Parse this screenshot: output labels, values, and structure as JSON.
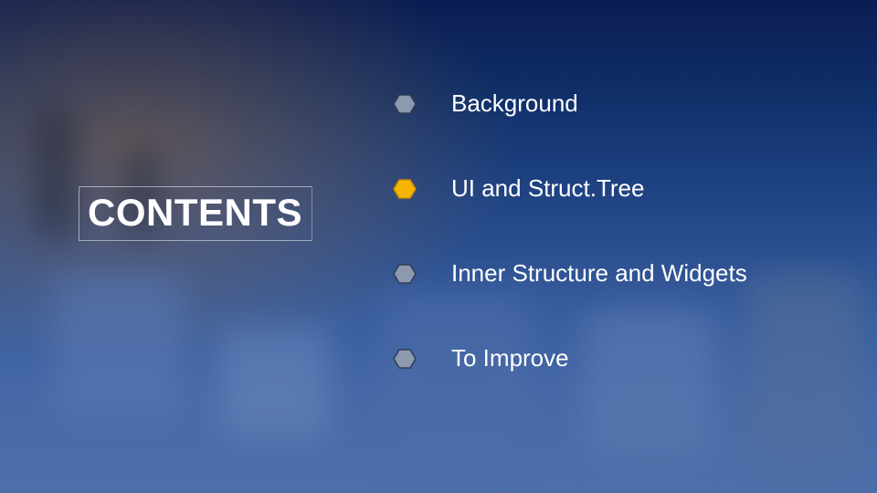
{
  "title": "CONTENTS",
  "colors": {
    "bullet_inactive": "#8c99af",
    "bullet_inactive_stroke": "#2e3d56",
    "bullet_active": "#f5b400",
    "bullet_active_stroke": "#c78a00",
    "text": "#ffffff"
  },
  "items": [
    {
      "label": "Background",
      "active": false
    },
    {
      "label": "UI and Struct.Tree",
      "active": true
    },
    {
      "label": "Inner Structure and Widgets",
      "active": false
    },
    {
      "label": "To Improve",
      "active": false
    }
  ]
}
